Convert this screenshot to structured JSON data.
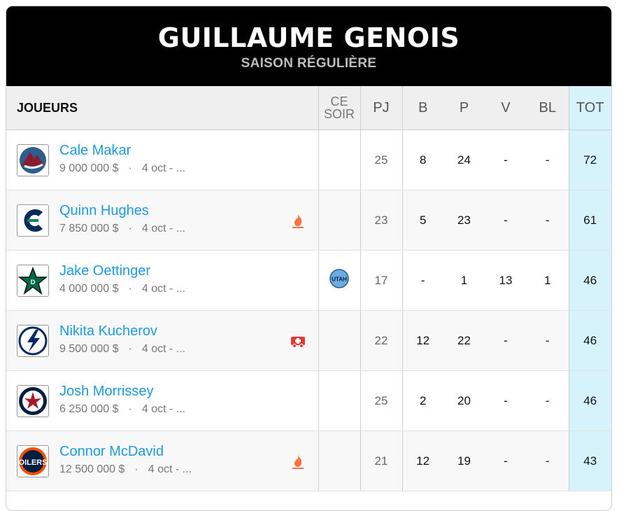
{
  "header": {
    "title": "GUILLAUME GENOIS",
    "subtitle": "SAISON RÉGULIÈRE"
  },
  "columns": {
    "players": "JOUEURS",
    "tonight_line1": "CE",
    "tonight_line2": "SOIR",
    "gp": "PJ",
    "goals": "B",
    "points": "P",
    "wins": "V",
    "shutouts": "BL",
    "total": "TOT"
  },
  "rows": [
    {
      "name": "Cale Makar",
      "salary": "9 000 000 $",
      "date": "4 oct - ...",
      "team_icon": "avalanche-logo-icon",
      "status_icon": "",
      "opponent": "",
      "gp": "25",
      "b": "8",
      "p": "24",
      "v": "-",
      "bl": "-",
      "tot": "72"
    },
    {
      "name": "Quinn Hughes",
      "salary": "7 850 000 $",
      "date": "4 oct - ...",
      "team_icon": "canucks-logo-icon",
      "status_icon": "fire-icon",
      "opponent": "",
      "gp": "23",
      "b": "5",
      "p": "23",
      "v": "-",
      "bl": "-",
      "tot": "61"
    },
    {
      "name": "Jake Oettinger",
      "salary": "4 000 000 $",
      "date": "4 oct - ...",
      "team_icon": "stars-logo-icon",
      "status_icon": "",
      "opponent": "UTAH",
      "gp": "17",
      "b": "-",
      "p": "1",
      "v": "13",
      "bl": "1",
      "tot": "46"
    },
    {
      "name": "Nikita Kucherov",
      "salary": "9 500 000 $",
      "date": "4 oct - ...",
      "team_icon": "lightning-logo-icon",
      "status_icon": "ambulance-icon",
      "opponent": "",
      "gp": "22",
      "b": "12",
      "p": "22",
      "v": "-",
      "bl": "-",
      "tot": "46"
    },
    {
      "name": "Josh Morrissey",
      "salary": "6 250 000 $",
      "date": "4 oct - ...",
      "team_icon": "jets-logo-icon",
      "status_icon": "",
      "opponent": "",
      "gp": "25",
      "b": "2",
      "p": "20",
      "v": "-",
      "bl": "-",
      "tot": "46"
    },
    {
      "name": "Connor McDavid",
      "salary": "12 500 000 $",
      "date": "4 oct - ...",
      "team_icon": "oilers-logo-icon",
      "status_icon": "fire-icon",
      "opponent": "",
      "gp": "21",
      "b": "12",
      "p": "19",
      "v": "-",
      "bl": "-",
      "tot": "43"
    }
  ],
  "colors": {
    "link": "#1e9be0",
    "total_bg": "#d6f3fb",
    "header_bg": "#000000",
    "fire": "#ff7043",
    "ambulance": "#e53935"
  }
}
